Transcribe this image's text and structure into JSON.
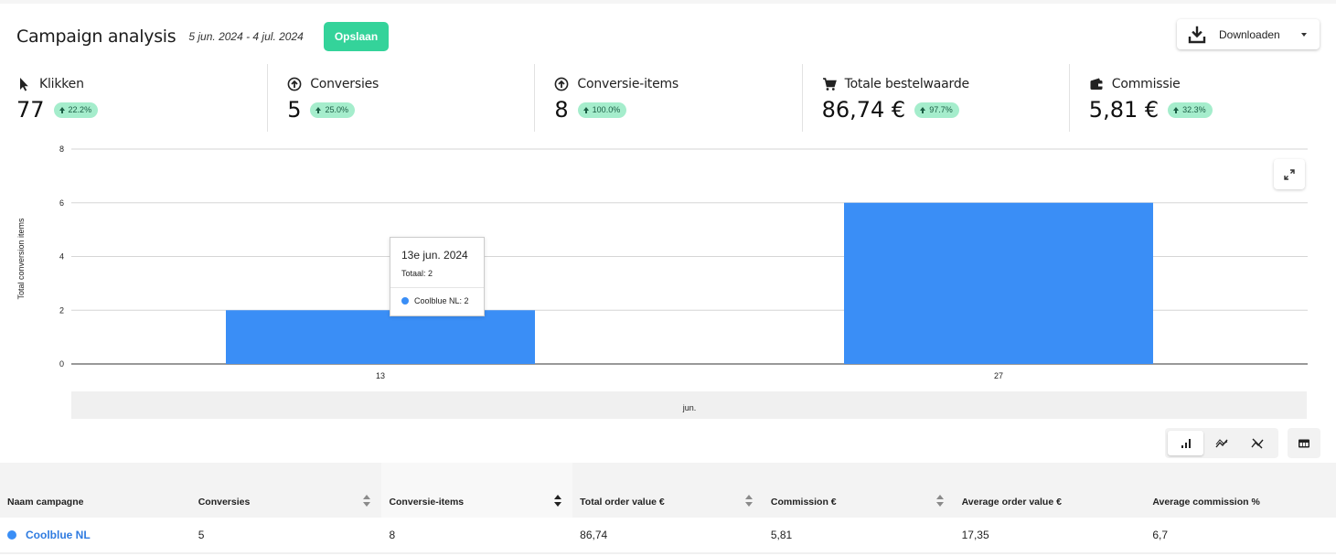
{
  "header": {
    "title": "Campaign analysis",
    "date_range": "5 jun. 2024 - 4 jul. 2024",
    "save_label": "Opslaan",
    "download_label": "Downloaden"
  },
  "kpis": [
    {
      "label": "Klikken",
      "value": "77",
      "change": "22.2%",
      "icon": "cursor-icon"
    },
    {
      "label": "Conversies",
      "value": "5",
      "change": "25.0%",
      "icon": "arrow-up-circle-icon"
    },
    {
      "label": "Conversie-items",
      "value": "8",
      "change": "100.0%",
      "icon": "arrow-up-circle-icon"
    },
    {
      "label": "Totale bestelwaarde",
      "value": "86,74 €",
      "change": "97.7%",
      "icon": "cart-icon"
    },
    {
      "label": "Commissie",
      "value": "5,81 €",
      "change": "32.3%",
      "icon": "wallet-icon"
    }
  ],
  "chart_data": {
    "type": "bar",
    "categories": [
      "13",
      "27"
    ],
    "series": [
      {
        "name": "Coolblue NL",
        "values": [
          2,
          6
        ],
        "color": "#3a8ef6"
      }
    ],
    "ylabel": "Total conversion items",
    "xgroup_label": "jun.",
    "ylim": [
      0,
      8
    ],
    "yticks": [
      "0",
      "2",
      "4",
      "6",
      "8"
    ],
    "grid": true
  },
  "tooltip": {
    "title": "13e jun. 2024",
    "total": "Totaal: 2",
    "item": "Coolblue NL: 2"
  },
  "table": {
    "headers": [
      "Naam campagne",
      "Conversies",
      "Conversie-items",
      "Total order value €",
      "Commission €",
      "Average order value €",
      "Average commission %"
    ],
    "rows": [
      [
        "Coolblue NL",
        "5",
        "8",
        "86,74",
        "5,81",
        "17,35",
        "6,7"
      ]
    ]
  },
  "colors": {
    "accent": "#34d39a",
    "bar": "#3a8ef6",
    "badge_bg": "#a5edcc",
    "link": "#2f7be0"
  }
}
